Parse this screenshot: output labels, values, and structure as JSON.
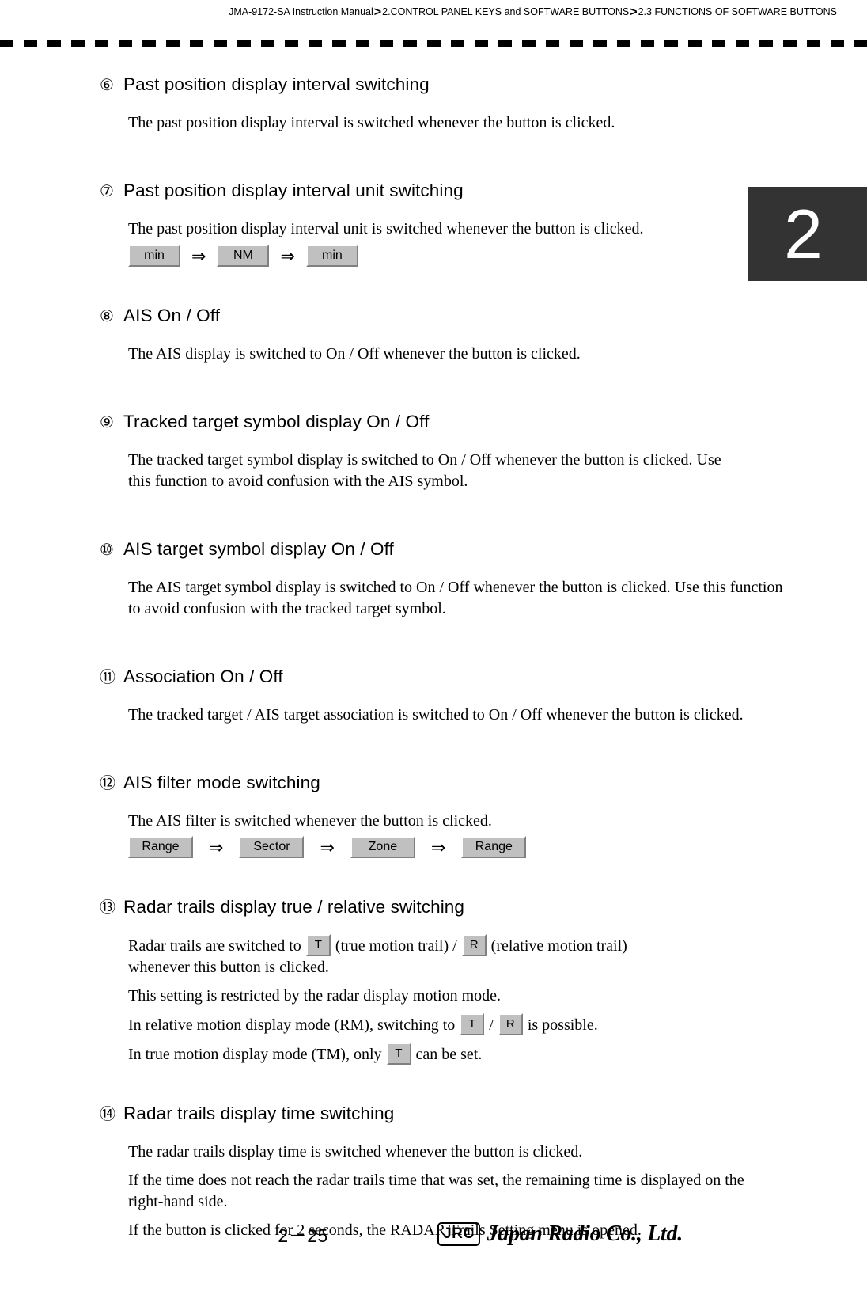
{
  "header": {
    "breadcrumb_parts": [
      "JMA-9172-SA Instruction Manual",
      "2.CONTROL PANEL KEYS and SOFTWARE BUTTONS",
      "2.3  FUNCTIONS OF SOFTWARE BUTTONS"
    ],
    "separator": ">"
  },
  "chapter_tab": {
    "number": "2"
  },
  "sections": [
    {
      "number": "⑥",
      "title": "Past position display interval switching",
      "paragraphs": [
        "The past position display interval is switched whenever the button is clicked."
      ]
    },
    {
      "number": "⑦",
      "title": "Past position display interval unit switching",
      "paragraphs": [
        "The past position display interval unit is switched whenever the button is clicked."
      ],
      "button_sequence": {
        "buttons": [
          "min",
          "NM",
          "min"
        ],
        "arrow": "⇒"
      }
    },
    {
      "number": "⑧",
      "title": "AIS On / Off",
      "paragraphs": [
        "The AIS display is switched to On / Off whenever the button is clicked."
      ]
    },
    {
      "number": "⑨",
      "title": "Tracked target symbol display On / Off",
      "paragraphs": [
        "The tracked target symbol display is switched to On / Off whenever the button is clicked. Use this function to avoid confusion with the AIS symbol."
      ]
    },
    {
      "number": "⑩",
      "title": "AIS target symbol display On / Off",
      "paragraphs": [
        "The AIS target symbol display is switched to On / Off whenever the button is clicked. Use this function to avoid confusion with the tracked target symbol."
      ]
    },
    {
      "number": "⑪",
      "title": "Association On / Off",
      "paragraphs": [
        "The tracked target / AIS target association is switched to On / Off whenever the button is clicked."
      ]
    },
    {
      "number": "⑫",
      "title": "AIS filter mode switching",
      "paragraphs": [
        "The AIS filter is switched whenever the button is clicked."
      ],
      "button_sequence": {
        "buttons": [
          "Range",
          "Sector",
          "Zone",
          "Range"
        ],
        "arrow": "⇒"
      }
    },
    {
      "number": "⑬",
      "title": "Radar trails display true / relative switching",
      "inline_lines": [
        {
          "parts": [
            {
              "type": "text",
              "value": "Radar trails are switched to"
            },
            {
              "type": "button",
              "value": "T"
            },
            {
              "type": "text",
              "value": "(true motion trail) /"
            },
            {
              "type": "button",
              "value": "R"
            },
            {
              "type": "text",
              "value": "(relative motion trail)"
            }
          ]
        },
        {
          "parts": [
            {
              "type": "text",
              "value": "whenever this button is clicked."
            }
          ]
        },
        {
          "parts": [
            {
              "type": "text",
              "value": "This setting is restricted by the radar display motion mode."
            }
          ]
        },
        {
          "parts": [
            {
              "type": "text",
              "value": "In relative motion display mode (RM), switching to"
            },
            {
              "type": "button",
              "value": "T"
            },
            {
              "type": "text",
              "value": "/"
            },
            {
              "type": "button",
              "value": "R"
            },
            {
              "type": "text",
              "value": "is possible."
            }
          ]
        },
        {
          "parts": [
            {
              "type": "text",
              "value": "In true motion display mode (TM), only"
            },
            {
              "type": "button",
              "value": "T"
            },
            {
              "type": "text",
              "value": "can be set."
            }
          ]
        }
      ]
    },
    {
      "number": "⑭",
      "title": "Radar trails display time switching",
      "paragraphs": [
        "The radar trails display time is switched whenever the button is clicked.",
        "If the time does not reach the radar trails time that was set, the remaining time is displayed on the right-hand side.",
        "If the button is clicked for 2 seconds, the RADAR Trails Setting menu is opened."
      ]
    }
  ],
  "footer": {
    "page_number": "2－25",
    "logo_mark": "JRC",
    "logo_text": "Japan Radio Co., Ltd."
  }
}
